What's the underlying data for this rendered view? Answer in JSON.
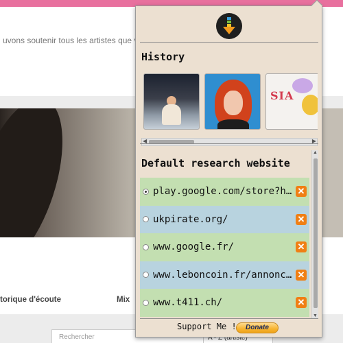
{
  "background_page": {
    "intro_text": "uvons soutenir tous les artistes que v",
    "tab_history": "torique d'écoute",
    "tab_mix": "Mix",
    "search_placeholder": "Rechercher",
    "sort_value": "A - Z (artiste)"
  },
  "popup": {
    "history_title": "History",
    "history_items": [
      {
        "label": "album-cover-1"
      },
      {
        "label": "album-cover-2"
      },
      {
        "label": "album-cover-3",
        "cover_text": "SIA"
      }
    ],
    "research_title": "Default research website",
    "websites": [
      {
        "url": "play.google.com/store?hl=fr",
        "selected": true
      },
      {
        "url": "ukpirate.org/",
        "selected": false
      },
      {
        "url": "www.google.fr/",
        "selected": false
      },
      {
        "url": "www.leboncoin.fr/annonces/",
        "selected": false
      },
      {
        "url": "www.t411.ch/",
        "selected": false
      }
    ],
    "delete_glyph": "✕",
    "support_text": "Support Me !",
    "donate_label": "Donate"
  },
  "colors": {
    "popup_bg": "#ece0d1",
    "row_green": "#c3dfb1",
    "row_blue": "#b8d3df",
    "delete_orange": "#f07f14"
  }
}
